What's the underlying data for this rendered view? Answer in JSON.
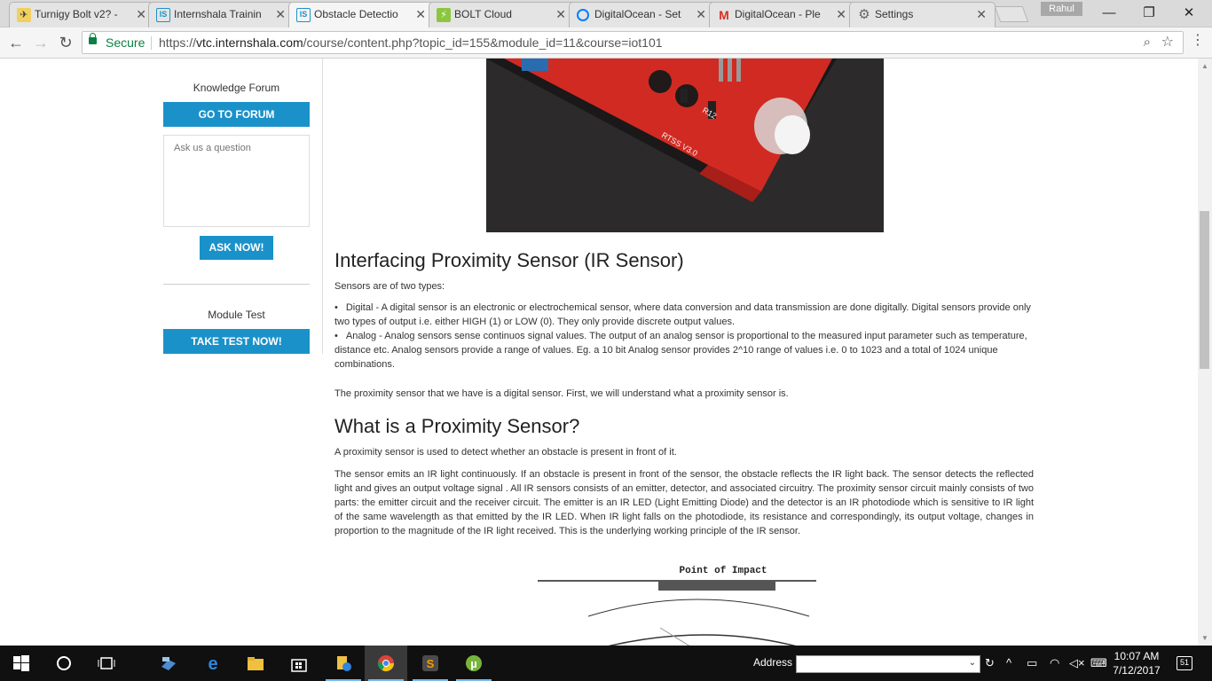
{
  "browser": {
    "tabs": [
      {
        "title": "Turnigy Bolt v2? -",
        "favicon": "plane-icon",
        "close": "✕",
        "active": false
      },
      {
        "title": "Internshala Trainin",
        "favicon": "IS",
        "close": "✕",
        "active": false
      },
      {
        "title": "Obstacle Detectio",
        "favicon": "IS",
        "close": "✕",
        "active": true
      },
      {
        "title": "BOLT Cloud",
        "favicon": "bolt-icon",
        "close": "✕",
        "active": false
      },
      {
        "title": "DigitalOcean - Set",
        "favicon": "digitalocean-icon",
        "close": "✕",
        "active": false
      },
      {
        "title": "DigitalOcean - Ple",
        "favicon": "M",
        "close": "✕",
        "active": false
      },
      {
        "title": "Settings",
        "favicon": "gear-icon",
        "close": "✕",
        "active": false
      }
    ],
    "profile_name": "Rahul",
    "window_controls": {
      "minimize": "—",
      "maximize": "❐",
      "close": "✕"
    },
    "nav": {
      "back": "←",
      "forward": "→",
      "reload": "↻"
    },
    "security_label": "Secure",
    "url_prefix": "https://",
    "url_domain": "vtc.internshala.com",
    "url_path": "/course/content.php?topic_id=155&module_id=11&course=iot101",
    "zoom_icon": "⌕",
    "star_icon": "☆",
    "menu_icon": "⋮"
  },
  "sidebar": {
    "forum_title": "Knowledge Forum",
    "forum_button": "GO TO FORUM",
    "ask_placeholder": "Ask us a question",
    "ask_button": "ASK NOW!",
    "test_title": "Module Test",
    "test_button": "TAKE TEST NOW!"
  },
  "content": {
    "image_label_1": "RTSS V3.0",
    "image_label_2": "R12",
    "heading1": "Interfacing Proximity Sensor (IR Sensor)",
    "intro": "Sensors are of two types:",
    "bullets": [
      "Digital - A digital sensor is an electronic or electrochemical sensor, where data conversion and data transmission are done digitally. Digital sensors provide only two types of output i.e. either HIGH (1) or LOW (0). They only provide discrete output values.",
      "Analog - Analog sensors sense continuos signal values. The output of an analog sensor is proportional to the measured input parameter such as temperature, distance etc. Analog sensors provide a range of values. Eg. a 10 bit Analog sensor provides 2^10 range of values i.e. 0 to 1023 and a total of 1024 unique combinations."
    ],
    "digital_note": "The proximity sensor that we have is a digital sensor. First, we will understand what a proximity sensor is.",
    "heading2": "What is a Proximity Sensor?",
    "definition": "A proximity sensor is used to detect whether an obstacle is present in front of it.",
    "explanation": "The sensor emits an IR light continuously. If an obstacle is present in front of the sensor, the obstacle reflects the IR light back. The sensor detects the reflected light and gives an output voltage signal . All IR sensors consists of an emitter, detector, and associated circuitry. The proximity sensor circuit mainly consists of two parts: the emitter circuit and the receiver circuit. The emitter is an IR LED (Light Emitting Diode) and the detector is an IR photodiode which is sensitive to IR light of the same wavelength as that emitted by the IR LED. When IR light falls on the photodiode, its resistance and correspondingly, its output voltage, changes in proportion to the magnitude of the IR light received. This is the underlying working principle of the IR sensor.",
    "diagram_label": "Point of Impact"
  },
  "taskbar": {
    "address_label": "Address",
    "clock_time": "10:07 AM",
    "clock_date": "7/12/2017",
    "notification_count": "51",
    "apps": [
      "start-icon",
      "cortana-icon",
      "task-view-icon",
      "people-icon",
      "edge-icon",
      "file-explorer-icon",
      "store-icon",
      "files-icon",
      "chrome-icon",
      "sublime-icon",
      "utorrent-icon"
    ]
  }
}
